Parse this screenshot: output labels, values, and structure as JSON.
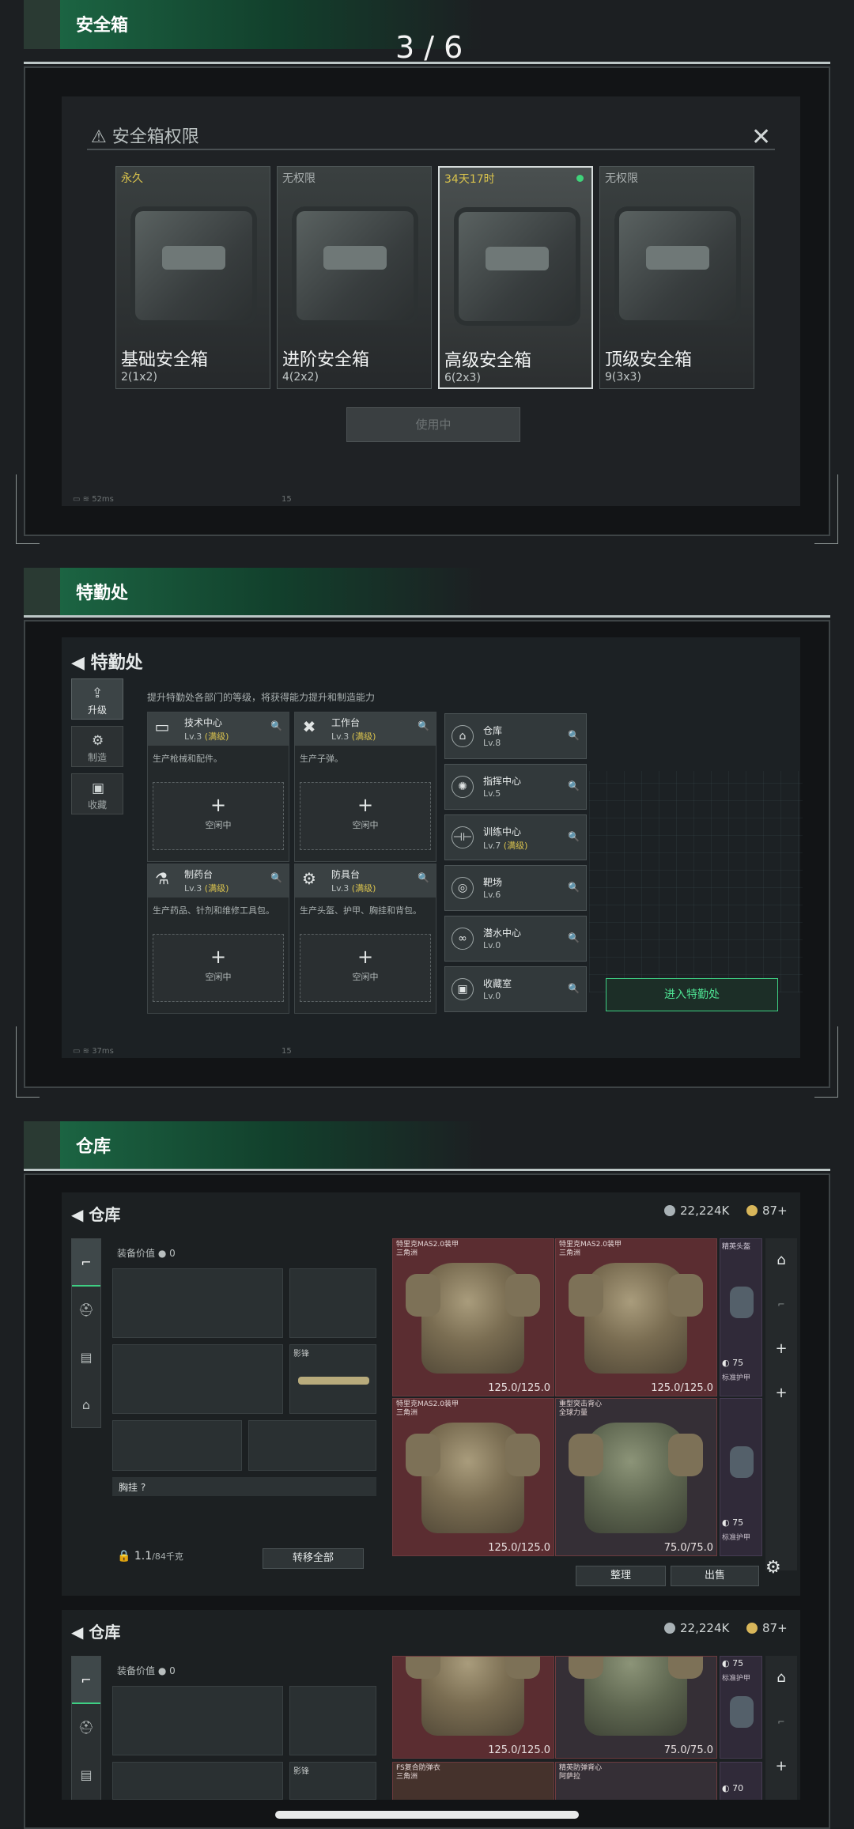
{
  "page_indicator": "3 / 6",
  "sections": {
    "safebox": "安全箱",
    "special_ops": "特勤处",
    "warehouse": "仓库"
  },
  "safebox": {
    "dialog_title": "安全箱权限",
    "cards": [
      {
        "tag": "永久",
        "name": "基础安全箱",
        "size": "2(1x2)"
      },
      {
        "tag": "无权限",
        "name": "进阶安全箱",
        "size": "4(2x2)"
      },
      {
        "tag": "34天17时",
        "name": "高级安全箱",
        "size": "6(2x3)"
      },
      {
        "tag": "无权限",
        "name": "顶级安全箱",
        "size": "9(3x3)"
      }
    ],
    "use_button": "使用中",
    "status_ping": "52ms",
    "status_num": "15"
  },
  "special_ops": {
    "title": "特勤处",
    "desc": "提升特勤处各部门的等级，将获得能力提升和制造能力",
    "side": [
      "升级",
      "制造",
      "收藏"
    ],
    "facilities": [
      {
        "name": "技术中心",
        "level": "Lv.3",
        "max": "(满级)",
        "desc": "生产枪械和配件。",
        "slot": "空闲中"
      },
      {
        "name": "工作台",
        "level": "Lv.3",
        "max": "(满级)",
        "desc": "生产子弹。",
        "slot": "空闲中"
      },
      {
        "name": "制药台",
        "level": "Lv.3",
        "max": "(满级)",
        "desc": "生产药品、针剂和维修工具包。",
        "slot": "空闲中"
      },
      {
        "name": "防具台",
        "level": "Lv.3",
        "max": "(满级)",
        "desc": "生产头盔、护甲、胸挂和背包。",
        "slot": "空闲中"
      }
    ],
    "rooms": [
      {
        "name": "仓库",
        "level": "Lv.8",
        "max": ""
      },
      {
        "name": "指挥中心",
        "level": "Lv.5",
        "max": ""
      },
      {
        "name": "训练中心",
        "level": "Lv.7",
        "max": "(满级)"
      },
      {
        "name": "靶场",
        "level": "Lv.6",
        "max": ""
      },
      {
        "name": "潜水中心",
        "level": "Lv.0",
        "max": ""
      },
      {
        "name": "收藏室",
        "level": "Lv.0",
        "max": ""
      }
    ],
    "enter_button": "进入特勤处",
    "status_ping": "37ms",
    "status_num": "15"
  },
  "warehouse": {
    "title": "仓库",
    "currency1": "22,224K",
    "currency2": "87+",
    "equip_value_label": "装备价值",
    "equip_value": "0",
    "knife_label": "影锋",
    "chest_label": "胸挂",
    "chest_q": "?",
    "weight": "1.1",
    "weight_max": "/84千克",
    "transfer_all": "转移全部",
    "sort": "整理",
    "sell": "出售",
    "armors": [
      {
        "title": "特里克MAS2.0装甲",
        "sub": "三角洲",
        "dur": "125.0/125.0",
        "style": "r"
      },
      {
        "title": "特里克MAS2.0装甲",
        "sub": "三角洲",
        "dur": "125.0/125.0",
        "style": "r"
      },
      {
        "title": "特里克MAS2.0装甲",
        "sub": "三角洲",
        "dur": "125.0/125.0",
        "style": "r"
      },
      {
        "title": "重型突击背心",
        "sub": "全球力量",
        "dur": "75.0/75.0",
        "style": "g"
      }
    ],
    "helmet_title": "精英头盔",
    "helmet_value": "75",
    "helmet_sub": "标准护甲",
    "second_armors": [
      {
        "title": "",
        "sub": "",
        "dur": "125.0/125.0",
        "style": "r"
      },
      {
        "title": "",
        "sub": "",
        "dur": "75.0/75.0",
        "style": "g"
      }
    ],
    "second_labels": [
      "FS复合防弹衣",
      "精英防弹背心"
    ],
    "second_subs": [
      "三角洲",
      "阿萨拉"
    ],
    "helmet_value2": "75",
    "helmet_value3": "70"
  }
}
